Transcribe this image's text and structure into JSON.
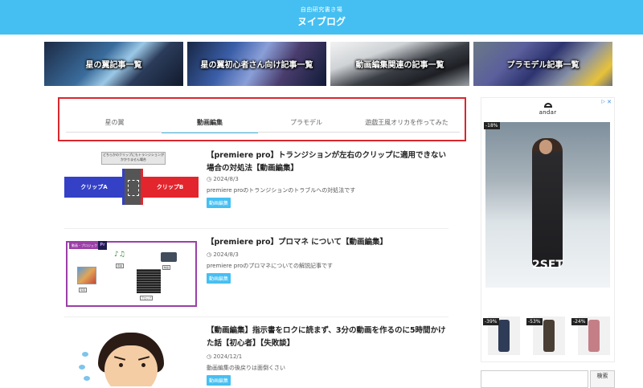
{
  "header": {
    "subtitle": "自由研究書き場",
    "title": "ヌイブログ"
  },
  "banners": [
    {
      "label": "星の翼記事一覧"
    },
    {
      "label": "星の翼初心者さん向け記事一覧"
    },
    {
      "label": "動画編集関連の記事一覧"
    },
    {
      "label": "プラモデル記事一覧"
    }
  ],
  "tabs": [
    {
      "label": "星の翼"
    },
    {
      "label": "動画編集"
    },
    {
      "label": "プラモデル"
    },
    {
      "label": "遊戯王風オリカを作ってみた"
    }
  ],
  "articles": [
    {
      "title": "【premiere pro】トランジションが左右のクリップに適用できない場合の対処法【動画編集】",
      "date": "2024/8/3",
      "desc": "premiere proのトランジションのトラブルへの対処法です",
      "badge": "動画編集",
      "thumb": {
        "note": "どちらかのクリップにもトランジションがかかりません場合",
        "left": "クリップA",
        "right": "クリップB"
      }
    },
    {
      "title": "【premiere pro】プロマネ について【動画編集】",
      "date": "2024/8/3",
      "desc": "premiere proのプロマネについての解説記事です",
      "badge": "動画編集",
      "thumb": {
        "tag": "動画・プロジェクト",
        "pr": "Pr",
        "cap1": "写真",
        "cap2": "音楽",
        "cap3": "動画",
        "cap4": "テロップ"
      }
    },
    {
      "title": "【動画編集】指示書をロクに読まず、3分の動画を作るのに5時間かけた話【初心者】【失敗談】",
      "date": "2024/12/1",
      "desc": "動画編集の後戻りは面倒くさい",
      "badge": "動画編集"
    }
  ],
  "ad": {
    "brand": "andar",
    "main_text": "2SET",
    "badge_main": "-18%",
    "items": [
      {
        "pct": "-39%"
      },
      {
        "pct": "-53%"
      },
      {
        "pct": "-24%"
      }
    ],
    "close": "✕",
    "info": "▷"
  },
  "search": {
    "button": "検索",
    "placeholder": ""
  },
  "colors": {
    "header": "#45bff2",
    "highlight_border": "#d9272e",
    "badge": "#45bff2"
  }
}
